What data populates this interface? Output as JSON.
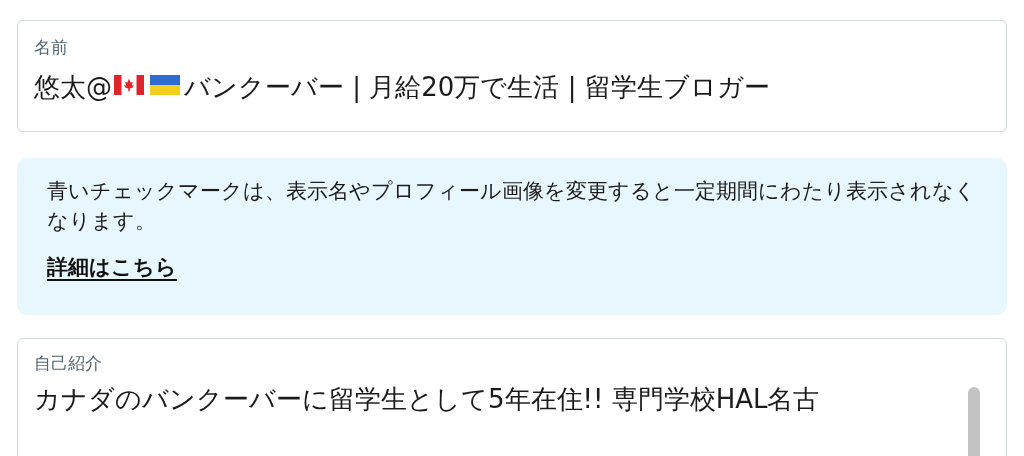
{
  "name_field": {
    "label": "名前",
    "value_before_flags": "悠太@",
    "value_after_flags": "バンクーバー | 月給20万で生活 | 留学生ブロガー"
  },
  "notice": {
    "text": "青いチェックマークは、表示名やプロフィール画像を変更すると一定期間にわたり表示されなくなります。",
    "link": "詳細はこちら"
  },
  "bio_field": {
    "label": "自己紹介",
    "value": "カナダのバンクーバーに留学生として5年在住!! 専門学校HAL名古"
  }
}
